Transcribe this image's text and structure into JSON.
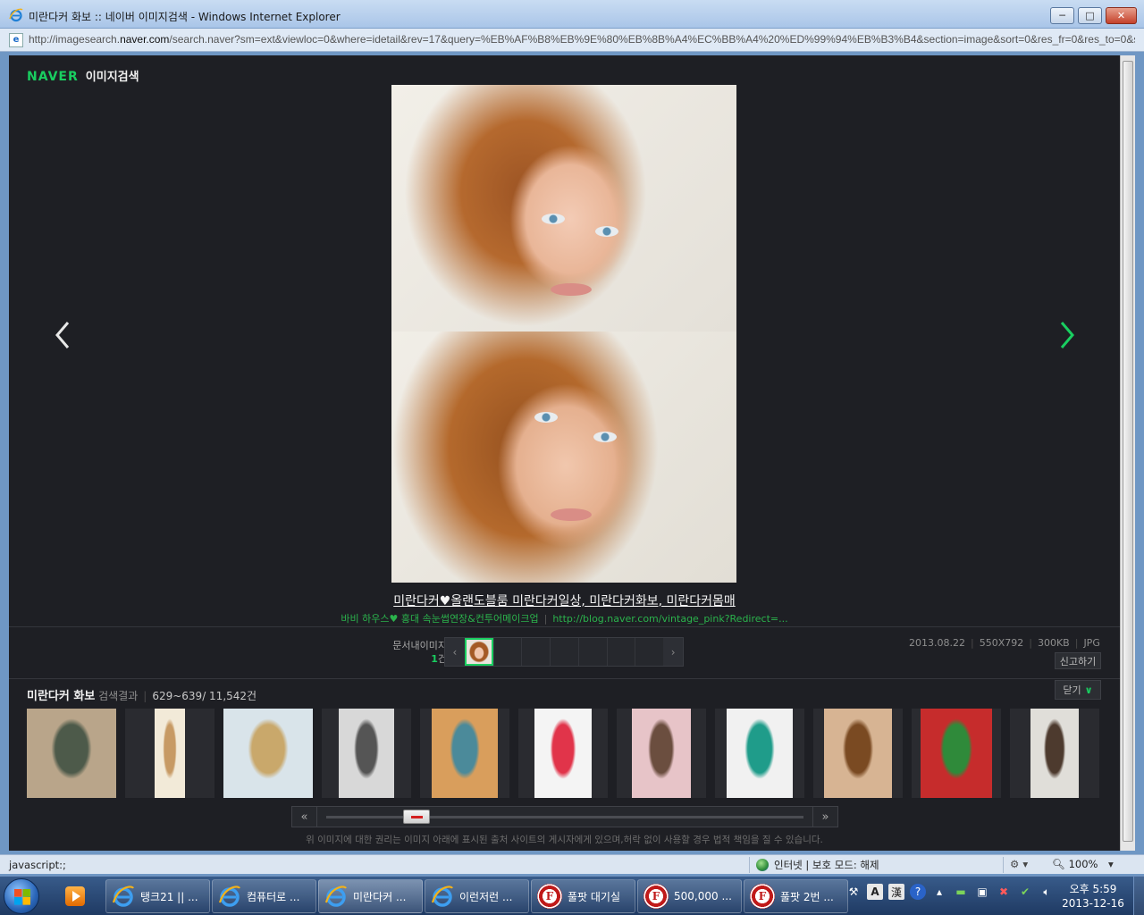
{
  "window": {
    "title": "미란다커 화보 :: 네이버 이미지검색 - Windows Internet Explorer",
    "minimize_label": "─",
    "maximize_label": "□",
    "close_label": "✕"
  },
  "address": {
    "url_prefix": "http://imagesearch.",
    "url_domain": "naver.com",
    "url_rest": "/search.naver?sm=ext&viewloc=0&where=idetail&rev=17&query=%EB%AF%B8%EB%9E%80%EB%8B%A4%EC%BB%A4%20%ED%99%94%EB%B3%B4&section=image&sort=0&res_fr=0&res_to=0&s"
  },
  "page": {
    "logo": "NAVER",
    "service": "이미지검색",
    "doc_title": "미란다커♥올랜도블룸 미란다커일상, 미란다커화보, 미란다커몸매",
    "source_name": "바비 하우스♥ 홍대 속눈썹연장&컨투어메이크업",
    "source_url": "http://blog.naver.com/vintage_pink?Redirect=...",
    "doc_images_label": "문서내이미지",
    "doc_images_count": "1",
    "doc_images_unit": "건",
    "meta": {
      "date": "2013.08.22",
      "size": "550X792",
      "filesize": "300KB",
      "format": "JPG"
    },
    "report_label": "신고하기",
    "results": {
      "query": "미란다커 화보",
      "suffix": " 검색결과",
      "range": "629~639/ 11,542건"
    },
    "close_label": "닫기",
    "slider_progress": 0.17,
    "copyright": "위 이미지에 대한 권리는 이미지 아래에 표시된 출처 사이트의 게시자에게 있으며,허락 없이 사용할 경우 법적 책임을 질 수 있습니다."
  },
  "thumbnails": [
    {
      "colors": [
        "#b9a58a",
        "#4d5a4a"
      ],
      "w": 100
    },
    {
      "colors": [
        "#f2ead8",
        "#c79a64"
      ],
      "w": 34
    },
    {
      "colors": [
        "#d9e4ea",
        "#c9a86b"
      ],
      "w": 100
    },
    {
      "colors": [
        "#d8d8d8",
        "#555555"
      ],
      "w": 62
    },
    {
      "colors": [
        "#d99e5c",
        "#4b8a9a"
      ],
      "w": 74
    },
    {
      "colors": [
        "#f4f4f4",
        "#e1344a"
      ],
      "w": 64
    },
    {
      "colors": [
        "#e7c4c8",
        "#6b4e3f"
      ],
      "w": 66
    },
    {
      "colors": [
        "#f1f1f1",
        "#1f9c8a"
      ],
      "w": 74
    },
    {
      "colors": [
        "#d7b493",
        "#7a4a22"
      ],
      "w": 76
    },
    {
      "colors": [
        "#c62c2c",
        "#2f8a3a"
      ],
      "w": 80
    },
    {
      "colors": [
        "#e0ded9",
        "#4d3a2e"
      ],
      "w": 54
    }
  ],
  "statusbar": {
    "text": "javascript:;",
    "zone": "인터넷 | 보호 모드: 해제",
    "zoom": "100%"
  },
  "taskbar": {
    "tasks": [
      {
        "label": "탱크21 || ...",
        "type": "ie"
      },
      {
        "label": "컴퓨터로 ...",
        "type": "ie"
      },
      {
        "label": "미란다커 ...",
        "type": "ie",
        "active": true
      },
      {
        "label": "이런저런 ...",
        "type": "ie"
      },
      {
        "label": "풀팟 대기실",
        "type": "f"
      },
      {
        "label": "500,000 ...",
        "type": "f"
      },
      {
        "label": "풀팟 2번 ...",
        "type": "f"
      }
    ],
    "time": "오후 5:59",
    "date": "2013-12-16"
  }
}
